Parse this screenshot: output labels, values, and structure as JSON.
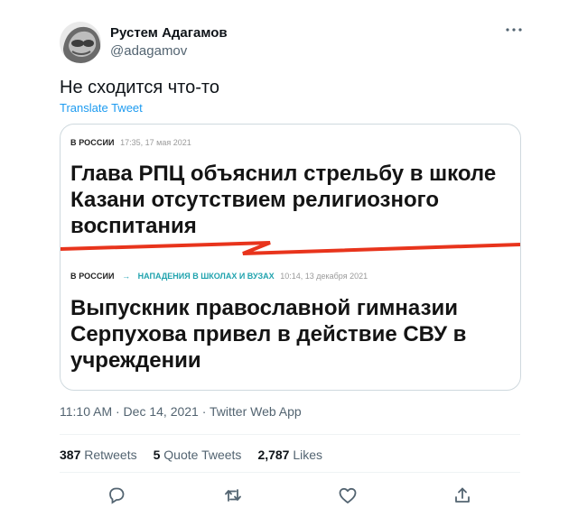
{
  "author": {
    "name": "Рустем Адагамов",
    "handle": "@adagamov"
  },
  "tweet": {
    "text": "Не сходится что-то",
    "translate_label": "Translate Tweet"
  },
  "card": {
    "top": {
      "section": "В РОССИИ",
      "time": "17:35, 17 мая 2021",
      "headline_lines": [
        "Глава РПЦ объяснил стрельбу в школе",
        "Казани отсутствием религиозного",
        "воспитания"
      ]
    },
    "divider_color": "#e8341c",
    "bottom": {
      "section": "В РОССИИ",
      "arrow": "→",
      "category": "НАПАДЕНИЯ В ШКОЛАХ И ВУЗАХ",
      "time": "10:14, 13 декабря 2021",
      "headline_lines": [
        "Выпускник православной гимназии",
        "Серпухова привел в действие СВУ в",
        "учреждении"
      ]
    }
  },
  "timestamp": "11:10 AM · Dec 14, 2021 · Twitter Web App",
  "stats": {
    "retweets": {
      "count": "387",
      "label": "Retweets"
    },
    "quotes": {
      "count": "5",
      "label": "Quote Tweets"
    },
    "likes": {
      "count": "2,787",
      "label": "Likes"
    }
  },
  "actions": [
    "reply-icon",
    "retweet-icon",
    "like-icon",
    "share-icon"
  ],
  "colors": {
    "accent": "#1d9bf0",
    "muted": "#536471",
    "card_accent": "#20a3ae"
  }
}
